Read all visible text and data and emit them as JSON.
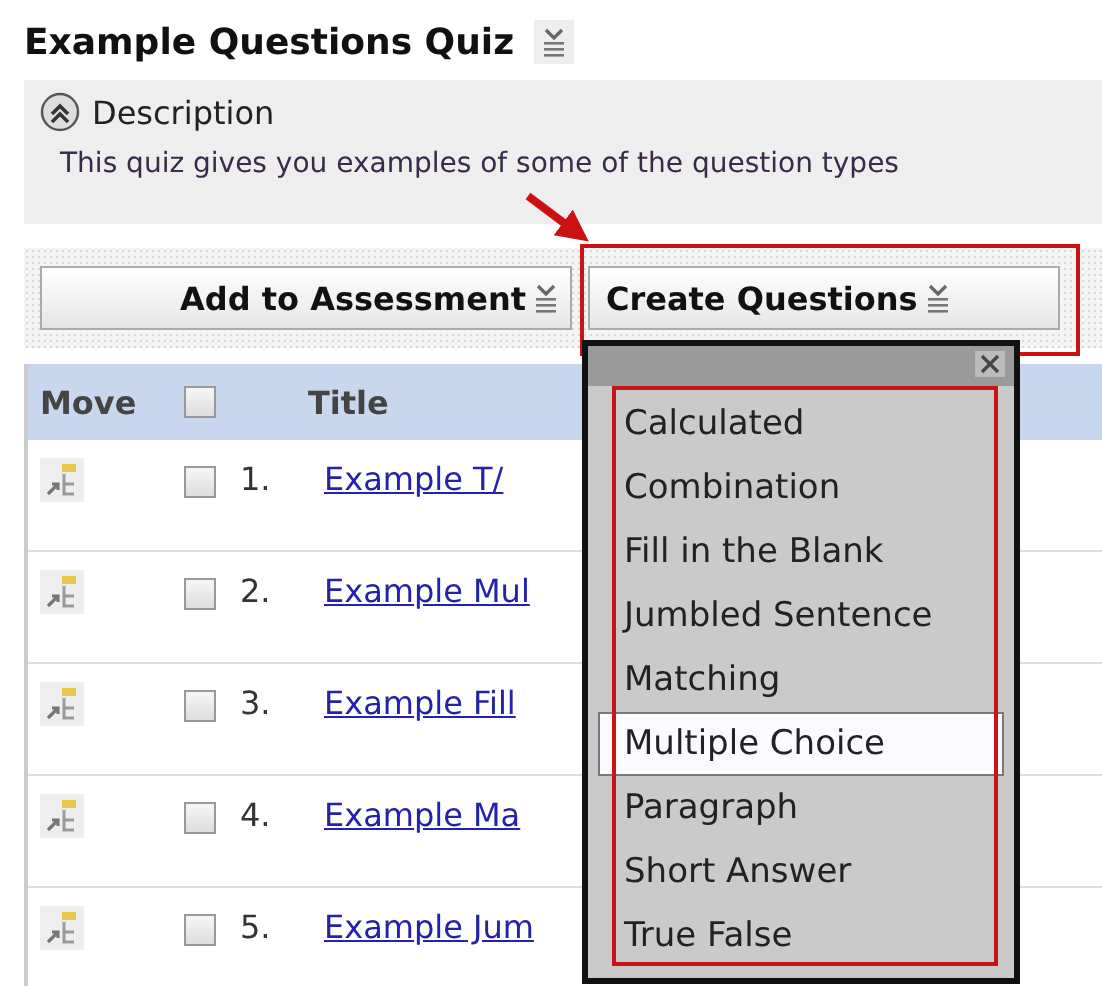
{
  "title": "Example Questions Quiz",
  "description": {
    "heading": "Description",
    "expanded": true,
    "text": "This quiz gives you examples of some of the question types"
  },
  "toolbar": {
    "buttons": [
      {
        "label": "Add to Assessment"
      },
      {
        "label": "Create Questions"
      }
    ]
  },
  "table": {
    "columns": [
      "Move",
      "Title"
    ],
    "header_checkbox": {
      "checked": false
    },
    "rows": [
      {
        "number": "1.",
        "title": "Example T/",
        "checked": false
      },
      {
        "number": "2.",
        "title": "Example Mul",
        "checked": false
      },
      {
        "number": "3.",
        "title": "Example Fill",
        "checked": false
      },
      {
        "number": "4.",
        "title": "Example Ma",
        "checked": false
      },
      {
        "number": "5.",
        "title": "Example Jum",
        "checked": false
      }
    ]
  },
  "menu": {
    "items": [
      {
        "label": "Calculated",
        "selected": false
      },
      {
        "label": "Combination",
        "selected": false
      },
      {
        "label": "Fill in the Blank",
        "selected": false
      },
      {
        "label": "Jumbled Sentence",
        "selected": false
      },
      {
        "label": "Matching",
        "selected": false
      },
      {
        "label": "Multiple Choice",
        "selected": true
      },
      {
        "label": "Paragraph",
        "selected": false
      },
      {
        "label": "Short Answer",
        "selected": false
      },
      {
        "label": "True False",
        "selected": false
      }
    ]
  }
}
